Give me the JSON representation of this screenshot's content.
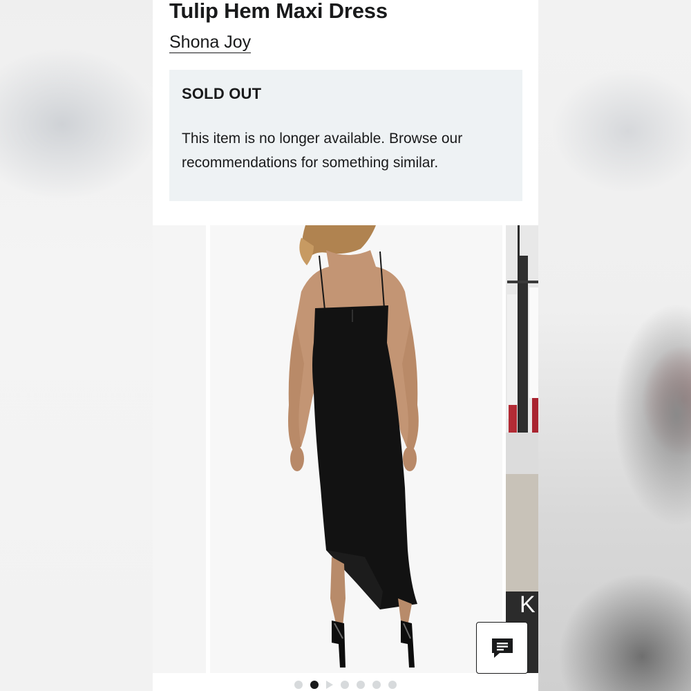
{
  "product": {
    "title": "Tulip Hem Maxi Dress",
    "brand": "Shona Joy"
  },
  "availability": {
    "status": "SOLD OUT",
    "message": "This item is no longer available. Browse our recommendations for something similar."
  },
  "carousel": {
    "slide_count": 7,
    "active_index": 1,
    "video_index": 2,
    "next_slide_caption": "K"
  },
  "chat": {
    "icon": "chat-bubble-icon"
  },
  "colors": {
    "text": "#191a1b",
    "notice_bg": "#eef2f4",
    "dot_inactive": "#d7dadc",
    "dot_active": "#191a1b"
  }
}
